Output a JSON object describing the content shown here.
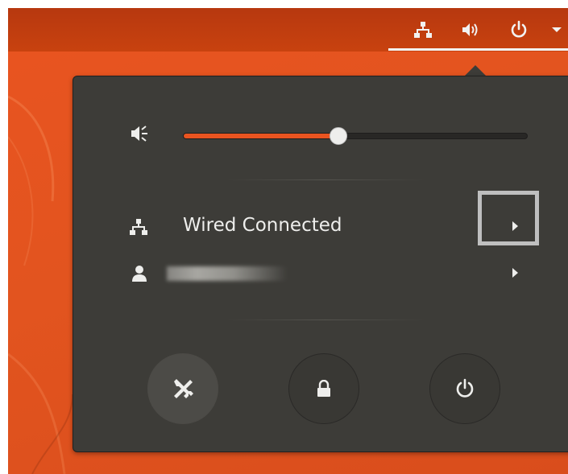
{
  "topbar": {
    "icons": [
      "network-wired-icon",
      "volume-icon",
      "power-icon",
      "dropdown-arrow-icon"
    ]
  },
  "volume": {
    "icon": "volume-muted-icon",
    "level": 0.45
  },
  "network": {
    "icon": "network-wired-icon",
    "label": "Wired Connected",
    "submenu_icon": "chevron-right-icon"
  },
  "user": {
    "icon": "user-icon",
    "name": "",
    "submenu_icon": "chevron-right-icon"
  },
  "actions": [
    {
      "name": "settings",
      "icon": "settings-tools-icon"
    },
    {
      "name": "lock",
      "icon": "lock-icon"
    },
    {
      "name": "power-off",
      "icon": "power-icon"
    }
  ],
  "colors": {
    "accent": "#e95420",
    "menu_bg": "#3d3c38",
    "text": "#eeeeec"
  }
}
